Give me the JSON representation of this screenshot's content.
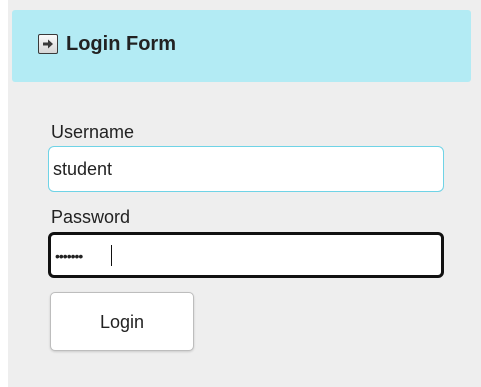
{
  "header": {
    "icon": "arrow-right-icon",
    "title": "Login Form"
  },
  "form": {
    "username_label": "Username",
    "username_value": "student",
    "password_label": "Password",
    "password_masked": "•••••••",
    "login_label": "Login"
  },
  "colors": {
    "header_bg": "#b3ebf4",
    "panel_bg": "#eeeeee",
    "focused_border": "#111111",
    "username_border": "#6fd3e6"
  }
}
